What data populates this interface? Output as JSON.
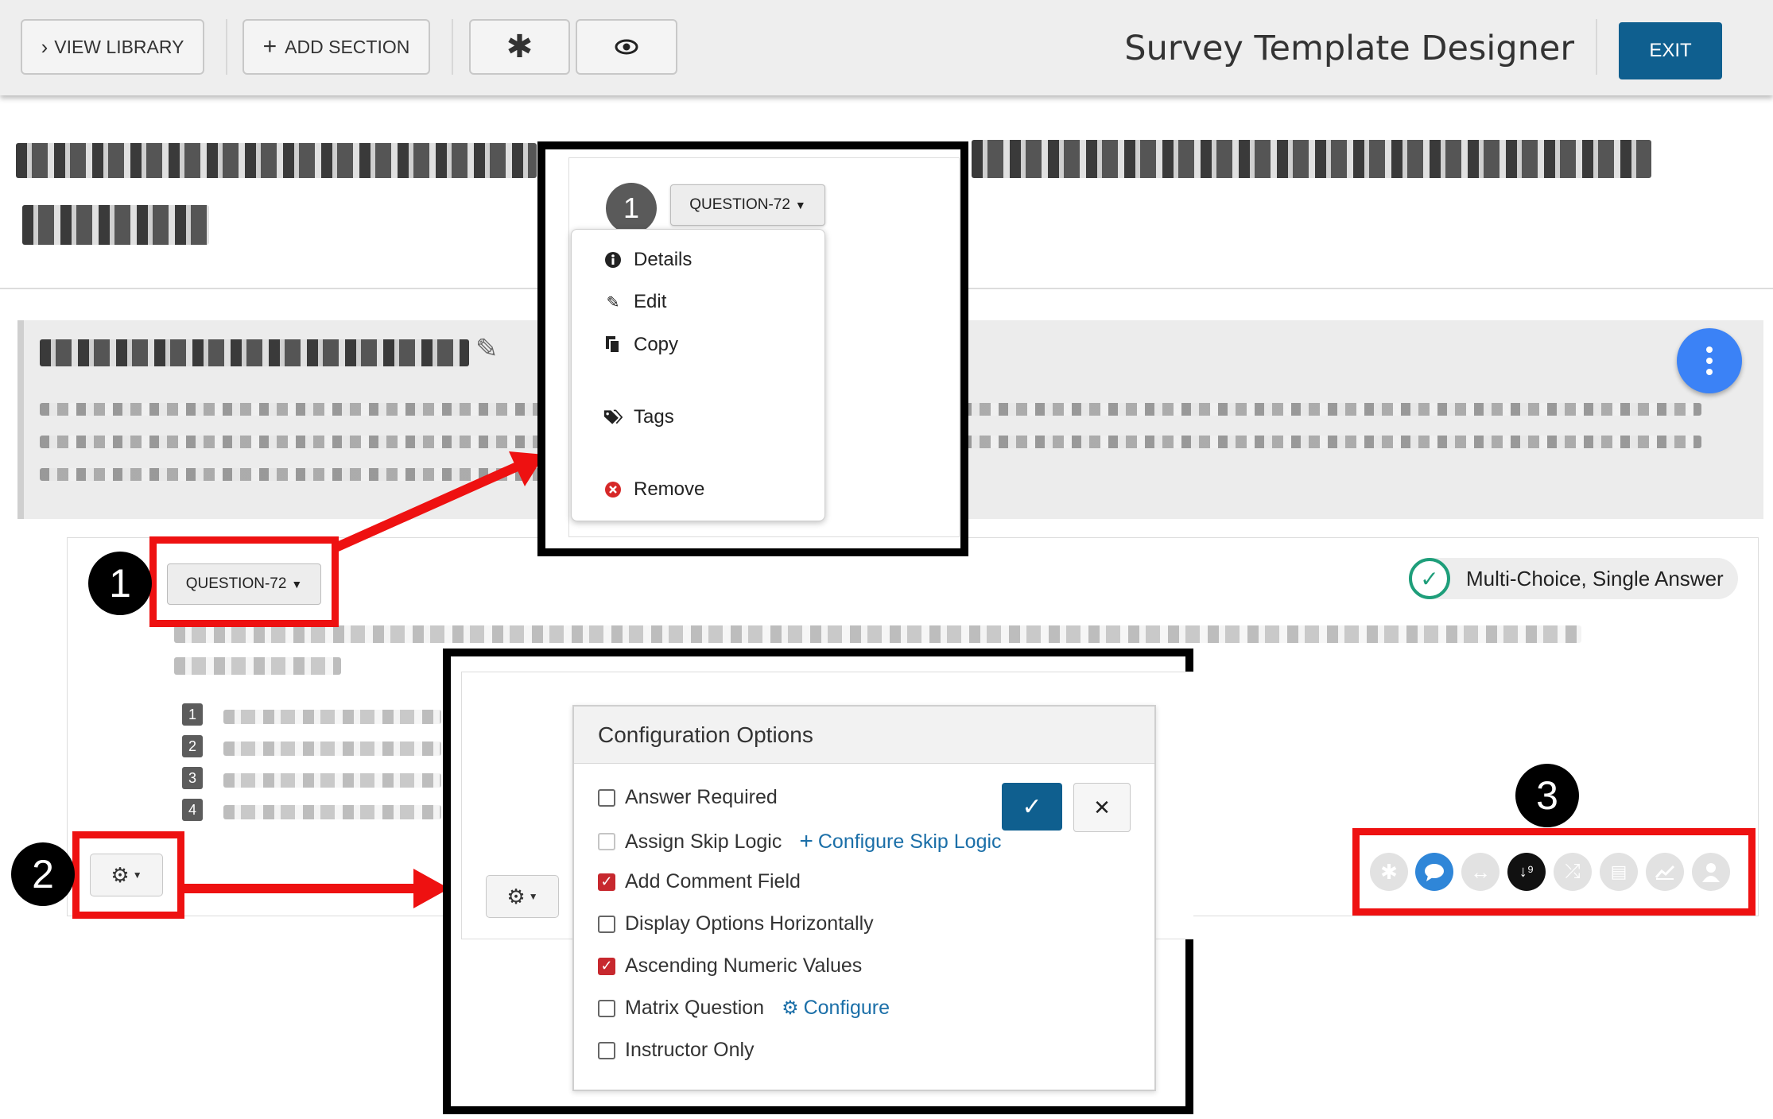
{
  "toolbar": {
    "view_library": "VIEW LIBRARY",
    "add_section": "ADD SECTION",
    "app_title": "Survey Template Designer",
    "exit": "EXIT"
  },
  "question": {
    "badge": "QUESTION-72",
    "type_label": "Multi-Choice, Single Answer",
    "option_numbers": [
      "1",
      "2",
      "3",
      "4"
    ]
  },
  "question_menu": {
    "number": "1",
    "badge": "QUESTION-72",
    "items": [
      {
        "label": "Details",
        "icon": "info-circle-icon"
      },
      {
        "label": "Edit",
        "icon": "pencil-icon"
      },
      {
        "label": "Copy",
        "icon": "copy-icon"
      },
      {
        "label": "Tags",
        "icon": "tags-icon"
      },
      {
        "label": "Remove",
        "icon": "remove-circle-icon"
      }
    ]
  },
  "config": {
    "title": "Configuration Options",
    "options": [
      {
        "label": "Answer Required",
        "checked": false
      },
      {
        "label": "Assign Skip Logic",
        "checked": false,
        "disabled": true,
        "link": "Configure Skip Logic"
      },
      {
        "label": "Add Comment Field",
        "checked": true
      },
      {
        "label": "Display Options Horizontally",
        "checked": false
      },
      {
        "label": "Ascending Numeric Values",
        "checked": true
      },
      {
        "label": "Matrix Question",
        "checked": false,
        "link": "Configure"
      },
      {
        "label": "Instructor Only",
        "checked": false
      }
    ]
  },
  "callouts": [
    "1",
    "2",
    "3"
  ],
  "icon_strip": [
    {
      "name": "required-asterisk-icon",
      "active": false
    },
    {
      "name": "comment-icon",
      "active": true,
      "color": "#2f86d8"
    },
    {
      "name": "horizontal-icon",
      "active": false
    },
    {
      "name": "sort-numeric-icon",
      "active": true,
      "color": "#111111"
    },
    {
      "name": "shuffle-icon",
      "active": false
    },
    {
      "name": "document-icon",
      "active": false
    },
    {
      "name": "chart-icon",
      "active": false
    },
    {
      "name": "user-icon",
      "active": false
    }
  ],
  "colors": {
    "accent": "#0f5f8f",
    "callout_red": "#ee1111",
    "check_red": "#c7282e",
    "link_blue": "#1b6fa8",
    "fab_blue": "#3b82f6",
    "success_green": "#1e9e7a"
  }
}
